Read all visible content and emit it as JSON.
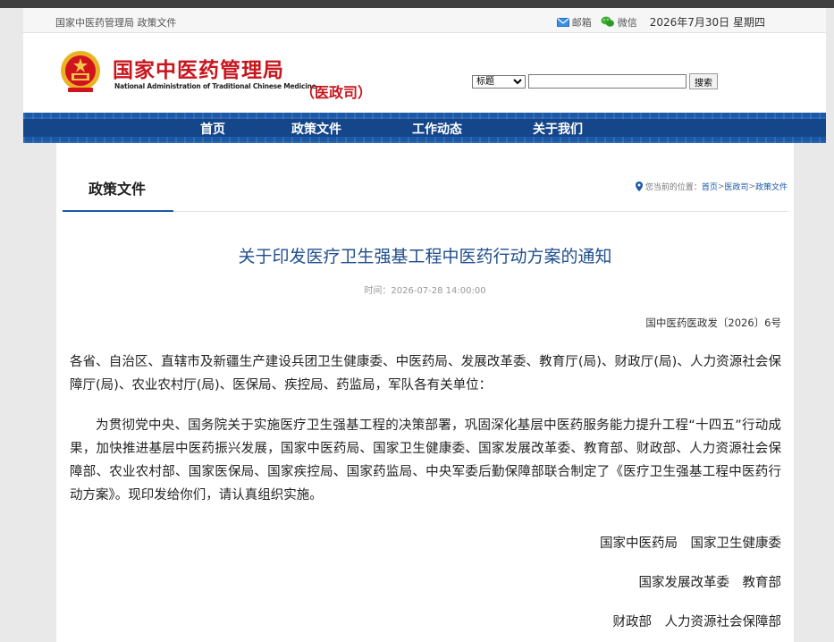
{
  "site": {
    "breadcrumb_top": "国家中医药管理局 政策文件",
    "mail_label": "邮箱",
    "wechat_label": "微信",
    "date": "2026年7月30日 星期四",
    "title_cn": "国家中医药管理局",
    "title_en": "National Administration of Traditional Chinese Medicine",
    "dept": "（医政司）"
  },
  "search": {
    "select_value": "标题",
    "button": "搜索",
    "value": ""
  },
  "nav": {
    "items": [
      "首页",
      "政策文件",
      "工作动态",
      "关于我们"
    ]
  },
  "section": {
    "tab": "政策文件",
    "location_prefix": "您当前的位置：",
    "location_home": "首页",
    "location_sep1": " > ",
    "location_dept": "医政司",
    "location_sep2": " > ",
    "location_current": "政策文件"
  },
  "document": {
    "title": "关于印发医疗卫生强基工程中医药行动方案的通知",
    "time": "时间：2026-07-28 14:00:00",
    "number": "国中医药医政发〔2026〕6号",
    "addressee": "各省、自治区、直辖市及新疆生产建设兵团卫生健康委、中医药局、发展改革委、教育厅(局)、财政厅(局)、人力资源社会保障厅(局)、农业农村厅(局)、医保局、疾控局、药监局，军队各有关单位：",
    "body": "为贯彻党中央、国务院关于实施医疗卫生强基工程的决策部署，巩固深化基层中医药服务能力提升工程“十四五”行动成果，加快推进基层中医药振兴发展，国家中医药局、国家卫生健康委、国家发展改革委、教育部、财政部、人力资源社会保障部、农业农村部、国家医保局、国家疾控局、国家药监局、中央军委后勤保障部联合制定了《医疗卫生强基工程中医药行动方案》。现印发给你们，请认真组织实施。",
    "signatories": [
      "国家中医药局　国家卫生健康委",
      "国家发展改革委　教育部",
      "财政部　人力资源社会保障部"
    ]
  },
  "colors": {
    "brand_red": "#c8161d",
    "nav_blue": "#1a58a8",
    "title_blue": "#1f4e8c"
  },
  "icons": [
    "mail-icon",
    "wechat-icon",
    "national-emblem",
    "location-pin-icon"
  ]
}
